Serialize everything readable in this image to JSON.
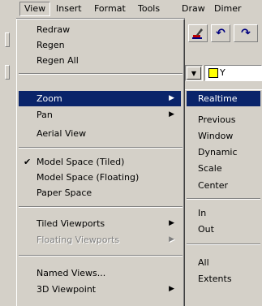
{
  "menubar": {
    "items": [
      {
        "label": "View",
        "active": true
      },
      {
        "label": "Insert"
      },
      {
        "label": "Format"
      },
      {
        "label": "Tools"
      },
      {
        "label": "Draw"
      },
      {
        "label": "Dimer"
      }
    ]
  },
  "view_menu": {
    "items": [
      {
        "label": "Redraw"
      },
      {
        "label": "Regen"
      },
      {
        "label": "Regen All"
      },
      {
        "label": "Zoom",
        "submenu": true,
        "highlighted": true
      },
      {
        "label": "Pan",
        "submenu": true
      },
      {
        "label": "Aerial View"
      },
      {
        "label": "Model Space (Tiled)",
        "checked": true
      },
      {
        "label": "Model Space (Floating)"
      },
      {
        "label": "Paper Space"
      },
      {
        "label": "Tiled Viewports",
        "submenu": true
      },
      {
        "label": "Floating Viewports",
        "submenu": true,
        "disabled": true
      },
      {
        "label": "Named Views..."
      },
      {
        "label": "3D Viewpoint",
        "submenu": true
      }
    ]
  },
  "zoom_submenu": {
    "items": [
      {
        "label": "Realtime",
        "highlighted": true
      },
      {
        "label": "Previous"
      },
      {
        "label": "Window"
      },
      {
        "label": "Dynamic"
      },
      {
        "label": "Scale"
      },
      {
        "label": "Center"
      },
      {
        "label": "In"
      },
      {
        "label": "Out"
      },
      {
        "label": "All"
      },
      {
        "label": "Extents"
      }
    ]
  },
  "toolbar": {
    "layer_name": "Y",
    "check_glyph": "✔",
    "arrow_glyph": "▶",
    "combo_arrow_glyph": "▼",
    "undo_glyph": "↶",
    "redo_glyph": "↷"
  },
  "colors": {
    "highlight": "#0a246a",
    "face": "#d4d0c8",
    "layer_swatch": "#ffff00"
  }
}
